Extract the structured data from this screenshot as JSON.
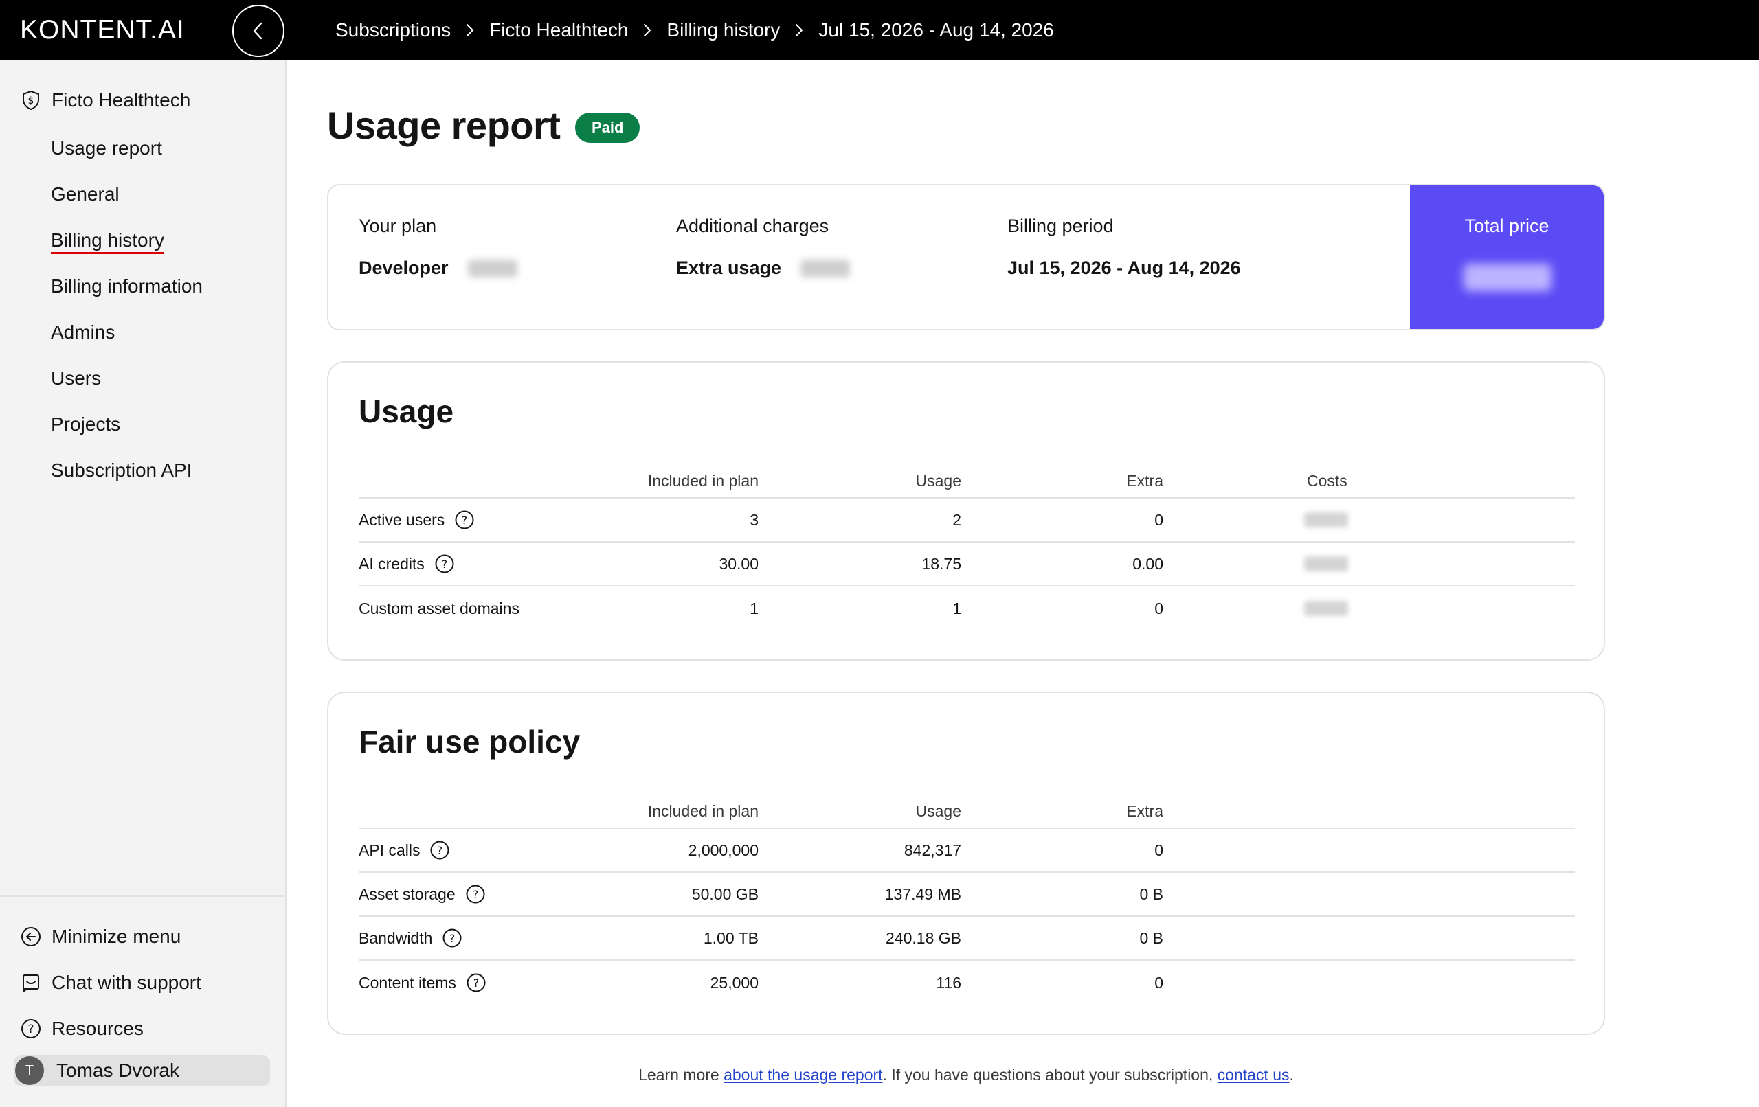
{
  "topbar": {
    "logo": "KONTENT.AI",
    "breadcrumbs": [
      "Subscriptions",
      "Ficto Healthtech",
      "Billing history",
      "Jul 15, 2026 - Aug 14, 2026"
    ]
  },
  "sidebar": {
    "org_name": "Ficto Healthtech",
    "items": [
      {
        "label": "Usage report",
        "active": false
      },
      {
        "label": "General",
        "active": false
      },
      {
        "label": "Billing history",
        "active": true
      },
      {
        "label": "Billing information",
        "active": false
      },
      {
        "label": "Admins",
        "active": false
      },
      {
        "label": "Users",
        "active": false
      },
      {
        "label": "Projects",
        "active": false
      },
      {
        "label": "Subscription API",
        "active": false
      }
    ],
    "bottom": {
      "minimize": "Minimize menu",
      "chat": "Chat with support",
      "resources": "Resources"
    },
    "user": {
      "initial": "T",
      "name": "Tomas Dvorak"
    }
  },
  "main": {
    "title": "Usage report",
    "status_badge": "Paid",
    "summary": {
      "plan_label": "Your plan",
      "plan_value": "Developer",
      "additional_label": "Additional charges",
      "additional_value": "Extra usage",
      "period_label": "Billing period",
      "period_value": "Jul 15, 2026 - Aug 14, 2026",
      "total_label": "Total price"
    },
    "usage": {
      "title": "Usage",
      "columns": [
        "Included in plan",
        "Usage",
        "Extra",
        "Costs"
      ],
      "rows": [
        {
          "name": "Active users",
          "help": true,
          "included": "3",
          "usage": "2",
          "extra": "0"
        },
        {
          "name": "AI credits",
          "help": true,
          "included": "30.00",
          "usage": "18.75",
          "extra": "0.00"
        },
        {
          "name": "Custom asset domains",
          "help": false,
          "included": "1",
          "usage": "1",
          "extra": "0"
        }
      ]
    },
    "fair_use": {
      "title": "Fair use policy",
      "columns": [
        "Included in plan",
        "Usage",
        "Extra"
      ],
      "rows": [
        {
          "name": "API calls",
          "help": true,
          "included": "2,000,000",
          "usage": "842,317",
          "extra": "0"
        },
        {
          "name": "Asset storage",
          "help": true,
          "included": "50.00 GB",
          "usage": "137.49 MB",
          "extra": "0 B"
        },
        {
          "name": "Bandwidth",
          "help": true,
          "included": "1.00 TB",
          "usage": "240.18 GB",
          "extra": "0 B"
        },
        {
          "name": "Content items",
          "help": true,
          "included": "25,000",
          "usage": "116",
          "extra": "0"
        }
      ]
    },
    "footer": {
      "prefix": "Learn more ",
      "link1": "about the usage report",
      "middle": ". If you have questions about your subscription, ",
      "link2": "contact us",
      "suffix": "."
    }
  }
}
